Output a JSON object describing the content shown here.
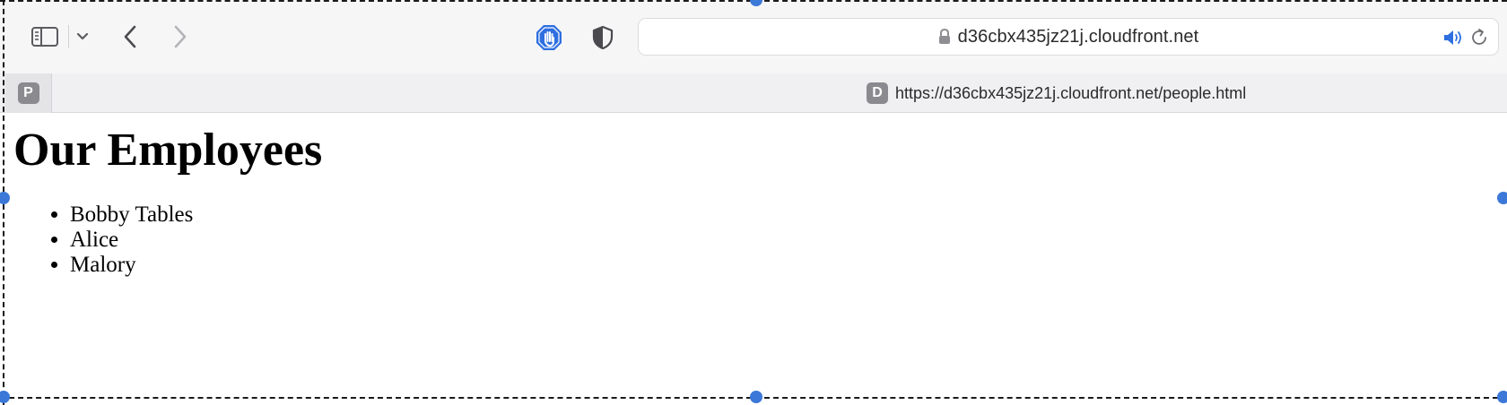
{
  "browser": {
    "address_text": "d36cbx435jz21j.cloudfront.net",
    "tabs": [
      {
        "favicon_letter": "P",
        "title": ""
      },
      {
        "favicon_letter": "D",
        "title": "https://d36cbx435jz21j.cloudfront.net/people.html"
      }
    ]
  },
  "page": {
    "title": "Our Employees",
    "employees": [
      "Bobby Tables",
      "Alice",
      "Malory"
    ]
  },
  "colors": {
    "toolbar_bg": "#f6f6f7",
    "accent_blue": "#2f6fe0",
    "selection_handle": "#3c78d8"
  },
  "icons": {
    "sidebar": "sidebar-icon",
    "chevron": "chevron-down-icon",
    "back": "chevron-left-icon",
    "forward": "chevron-right-icon",
    "blocker": "hand-stop-icon",
    "privacy": "shield-icon",
    "lock": "lock-icon",
    "audio": "speaker-icon",
    "reload": "reload-icon"
  }
}
